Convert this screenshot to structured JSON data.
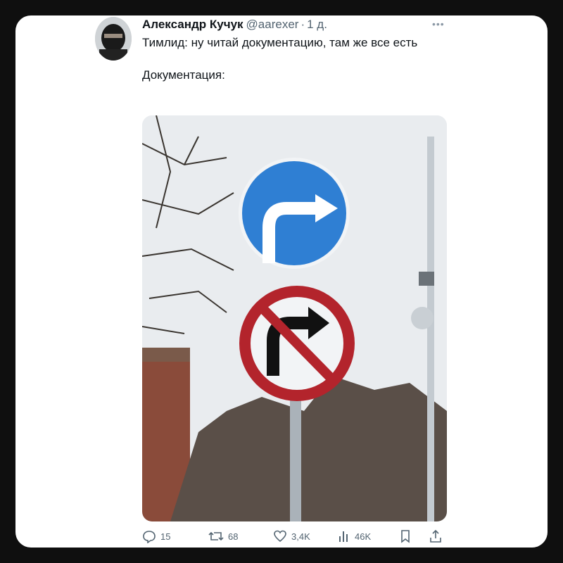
{
  "tweet": {
    "author_name": "Александр Кучук",
    "handle": "@aarexer",
    "separator": "·",
    "time": "1 д.",
    "text_line1": "Тимлид: ну читай документацию, там же все есть",
    "text_line2": "Документация:"
  },
  "actions": {
    "replies": "15",
    "retweets": "68",
    "likes": "3,4K",
    "views": "46K"
  },
  "icons": {
    "more": "more-icon",
    "reply": "reply-icon",
    "retweet": "retweet-icon",
    "like": "like-icon",
    "views": "views-icon",
    "bookmark": "bookmark-icon",
    "share": "share-icon"
  },
  "colors": {
    "background": "#0f0f0f",
    "card": "#ffffff",
    "text": "#0f1419",
    "muted": "#536471",
    "sign_blue": "#2f7fd3",
    "sign_red": "#b3242c"
  }
}
